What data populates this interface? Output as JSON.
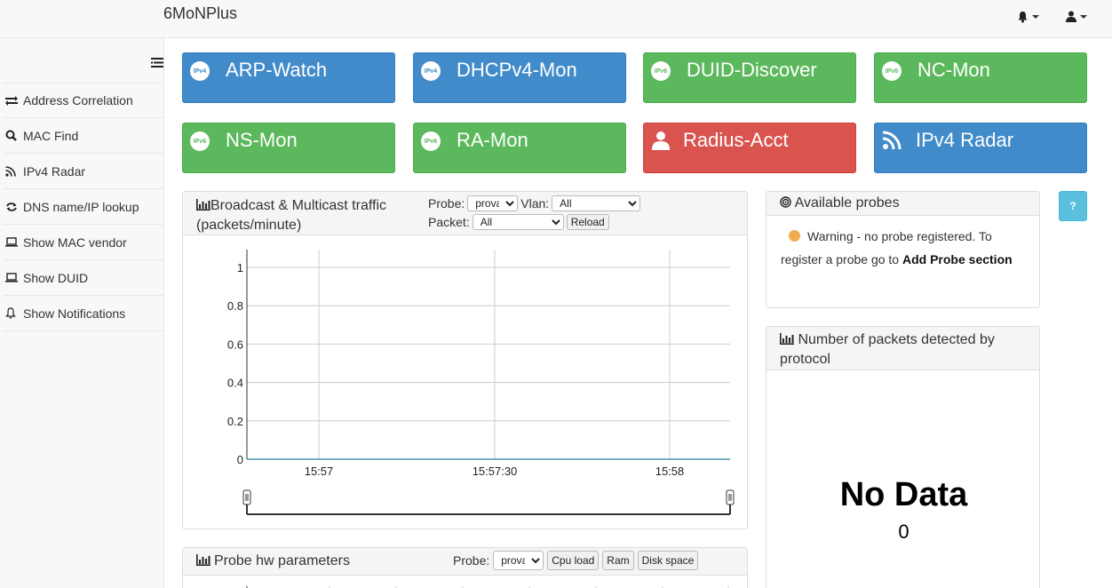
{
  "app": {
    "brand": "6MoNPlus"
  },
  "topbar": {
    "bell_icon": "bell-icon",
    "user_icon": "user-icon"
  },
  "sidebar": {
    "items": [
      {
        "label": "Address Correlation",
        "icon": "exchange-icon"
      },
      {
        "label": "MAC Find",
        "icon": "search-icon"
      },
      {
        "label": "IPv4 Radar",
        "icon": "rss-icon"
      },
      {
        "label": "DNS name/IP lookup",
        "icon": "refresh-icon"
      },
      {
        "label": "Show MAC vendor",
        "icon": "laptop-icon"
      },
      {
        "label": "Show DUID",
        "icon": "laptop-icon"
      },
      {
        "label": "Show Notifications",
        "icon": "bell-icon"
      }
    ]
  },
  "tiles": [
    {
      "label": "ARP-Watch",
      "badge": "IPv4",
      "color": "#428bca"
    },
    {
      "label": "DHCPv4-Mon",
      "badge": "IPv4",
      "color": "#428bca"
    },
    {
      "label": "DUID-Discover",
      "badge": "IPv6",
      "color": "#5cb85c"
    },
    {
      "label": "NC-Mon",
      "badge": "IPv6",
      "color": "#5cb85c"
    },
    {
      "label": "NS-Mon",
      "badge": "IPv6",
      "color": "#5cb85c"
    },
    {
      "label": "RA-Mon",
      "badge": "IPv6",
      "color": "#5cb85c"
    },
    {
      "label": "Radius-Acct",
      "badge": "",
      "color": "#d9534f"
    },
    {
      "label": "IPv4 Radar",
      "badge": "",
      "color": "#428bca"
    }
  ],
  "traffic_panel": {
    "title_line1": "Broadcast & Multicast traffic",
    "title_line2": "(packets/minute)",
    "probe_label": "Probe:",
    "probe_value": "prova",
    "vlan_label": "Vlan:",
    "vlan_value": "All",
    "packet_label": "Packet:",
    "packet_value": "All",
    "reload_label": "Reload"
  },
  "chart_data": {
    "type": "line",
    "title": "",
    "x": [
      "15:57",
      "15:57:30",
      "15:58"
    ],
    "yticks": [
      "0",
      "0.2",
      "0.4",
      "0.6",
      "0.8",
      "1"
    ],
    "ylim": [
      0,
      1
    ],
    "series": [
      {
        "values": [
          0,
          0,
          0
        ]
      }
    ],
    "grid": true,
    "color": "#2b7a9e"
  },
  "probes_panel": {
    "title": "Available probes",
    "warning_text": "Warning - no probe registered. To register a probe go to",
    "link_text": "Add Probe section",
    "status_color": "#f0ad4e"
  },
  "packets_panel": {
    "title": "Number of packets detected by protocol",
    "no_data": "No Data",
    "count": "0"
  },
  "hw_panel": {
    "title": "Probe hw parameters",
    "probe_label": "Probe:",
    "probe_value": "prova",
    "buttons": [
      "Cpu load",
      "Ram",
      "Disk space"
    ]
  },
  "help_label": "?"
}
